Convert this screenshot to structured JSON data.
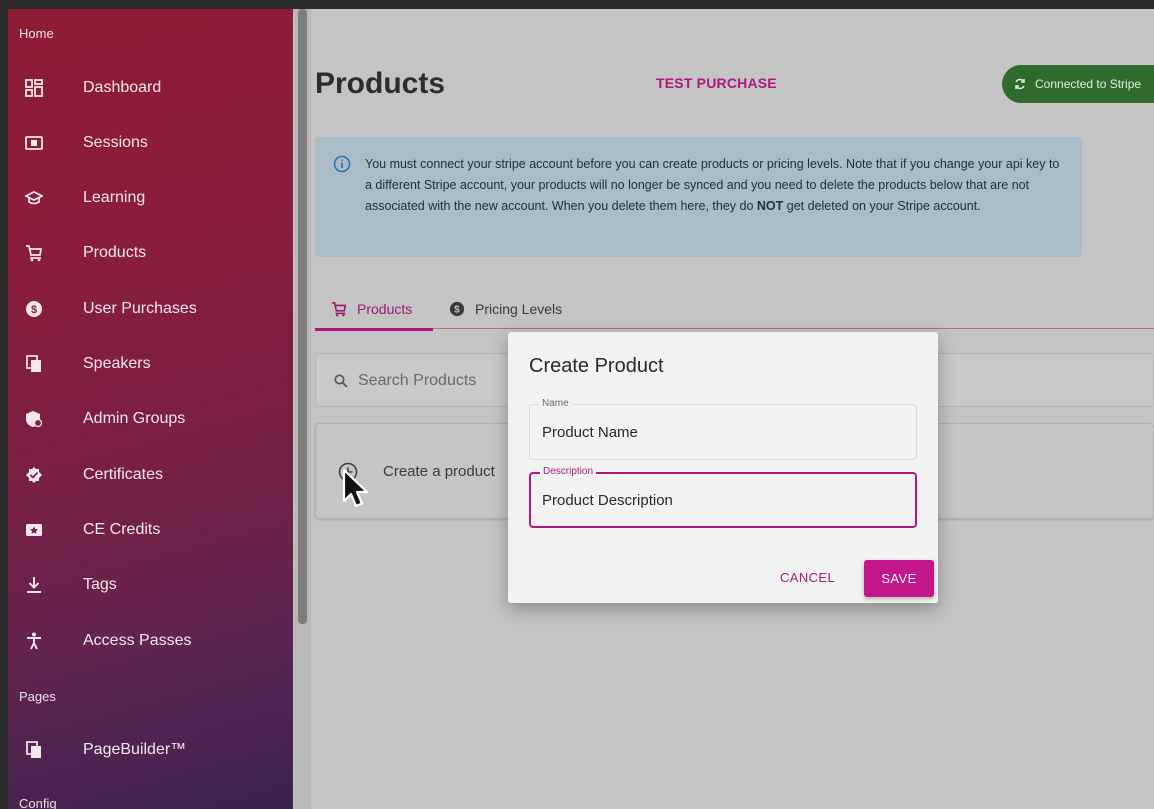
{
  "sidebar": {
    "section_home": "Home",
    "section_pages": "Pages",
    "section_config": "Config",
    "items": [
      {
        "label": "Dashboard",
        "icon": "dashboard-icon"
      },
      {
        "label": "Sessions",
        "icon": "sessions-icon"
      },
      {
        "label": "Learning",
        "icon": "learning-icon"
      },
      {
        "label": "Products",
        "icon": "cart-icon"
      },
      {
        "label": "User Purchases",
        "icon": "dollar-icon"
      },
      {
        "label": "Speakers",
        "icon": "speakers-icon"
      },
      {
        "label": "Admin Groups",
        "icon": "admin-groups-icon"
      },
      {
        "label": "Certificates",
        "icon": "certificate-icon"
      },
      {
        "label": "CE Credits",
        "icon": "ce-credits-icon"
      },
      {
        "label": "Tags",
        "icon": "tags-icon"
      },
      {
        "label": "Access Passes",
        "icon": "accessibility-icon"
      }
    ],
    "pages_items": [
      {
        "label": "PageBuilder™",
        "icon": "pagebuilder-icon"
      }
    ]
  },
  "header": {
    "title": "Products",
    "test_purchase": "TEST PURCHASE",
    "stripe_status": "Connected to Stripe"
  },
  "alert": {
    "text_before": "You must connect your stripe account before you can create products or pricing levels. Note that if you change your api key to a different Stripe account, your products will no longer be synced and you need to delete the products below that are not associated with the new account. When you delete them here, they do ",
    "text_bold": "NOT",
    "text_after": " get deleted on your Stripe account."
  },
  "tabs": [
    {
      "label": "Products",
      "active": true
    },
    {
      "label": "Pricing Levels",
      "active": false
    }
  ],
  "search": {
    "placeholder": "Search Products",
    "value": ""
  },
  "create_row": {
    "label": "Create a product"
  },
  "dialog": {
    "title": "Create Product",
    "name_label": "Name",
    "name_value": "Product Name",
    "description_label": "Description",
    "description_value": "Product Description",
    "cancel_label": "CANCEL",
    "save_label": "SAVE"
  },
  "colors": {
    "accent": "#b0177f",
    "stripe_green": "#2f6b2c",
    "alert_bg": "#a9bcc7"
  }
}
